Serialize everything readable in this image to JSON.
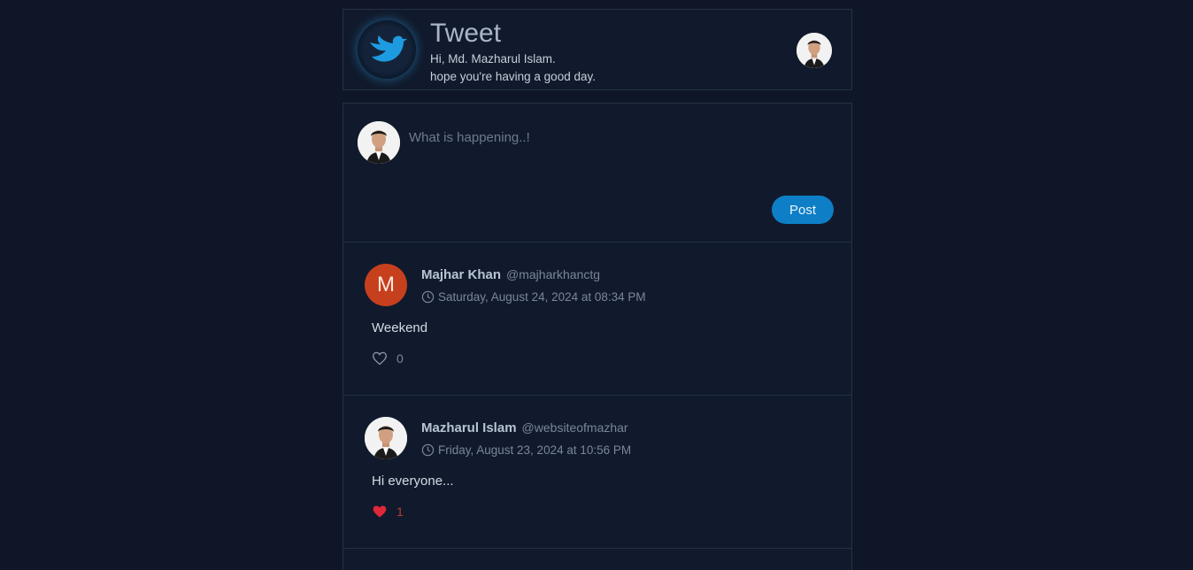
{
  "header": {
    "title": "Tweet",
    "greeting_line1": "Hi, Md. Mazharul Islam.",
    "greeting_line2": "hope you're having a good day.",
    "logo_icon": "bird-icon",
    "accent": "#0e7fc6"
  },
  "composer": {
    "placeholder": "What is happening..!",
    "post_label": "Post"
  },
  "tweets": [
    {
      "avatar_letter": "M",
      "name": "Majhar Khan",
      "handle": "@majharkhanctg",
      "timestamp": "Saturday, August 24, 2024 at 08:34 PM",
      "text": "Weekend",
      "likes": "0",
      "liked": false
    },
    {
      "name": "Mazharul Islam",
      "handle": "@websiteofmazhar",
      "timestamp": "Friday, August 23, 2024 at 10:56 PM",
      "text": "Hi everyone...",
      "likes": "1",
      "liked": true
    }
  ]
}
